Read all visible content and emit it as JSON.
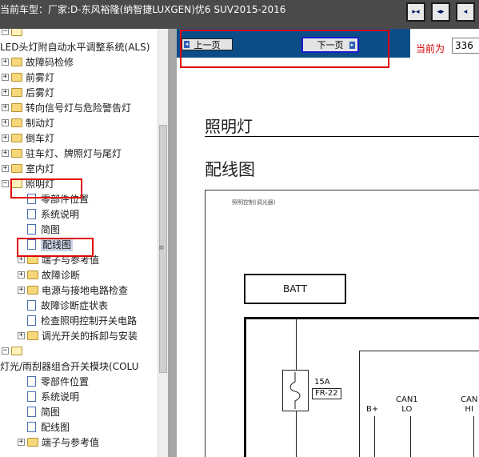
{
  "header": {
    "vehicle_info": "当前车型：厂家:D-东风裕隆(纳智捷LUXGEN)优6 SUV2015-2016",
    "buttons": [
      {
        "icon": "collapse-tree-icon",
        "glyph": "▸◂"
      },
      {
        "icon": "expand-tree-icon",
        "glyph": "◂▸"
      },
      {
        "icon": "maximize-icon",
        "glyph": "◂"
      }
    ]
  },
  "tree": {
    "items": [
      {
        "label": "",
        "expander": "−",
        "kind": "folder-open",
        "level": 0
      },
      {
        "label": "LED头灯附自动水平调整系统(ALS)",
        "expander": "",
        "kind": "text",
        "level": 0
      },
      {
        "label": "故障码检修",
        "expander": "+",
        "kind": "folder",
        "level": 1
      },
      {
        "label": "前雾灯",
        "expander": "+",
        "kind": "folder",
        "level": 1
      },
      {
        "label": "后雾灯",
        "expander": "+",
        "kind": "folder",
        "level": 1
      },
      {
        "label": "转向信号灯与危险警告灯",
        "expander": "+",
        "kind": "folder",
        "level": 1
      },
      {
        "label": "制动灯",
        "expander": "+",
        "kind": "folder",
        "level": 1
      },
      {
        "label": "倒车灯",
        "expander": "+",
        "kind": "folder",
        "level": 1
      },
      {
        "label": "驻车灯、牌照灯与尾灯",
        "expander": "+",
        "kind": "folder",
        "level": 1
      },
      {
        "label": "室内灯",
        "expander": "+",
        "kind": "folder",
        "level": 1
      },
      {
        "label": "照明灯",
        "expander": "−",
        "kind": "folder-open",
        "level": 1
      },
      {
        "label": "零部件位置",
        "expander": "",
        "kind": "doc",
        "level": 2
      },
      {
        "label": "系统说明",
        "expander": "",
        "kind": "doc",
        "level": 2
      },
      {
        "label": "简图",
        "expander": "",
        "kind": "doc",
        "level": 2
      },
      {
        "label": "配线图",
        "expander": "",
        "kind": "doc",
        "level": 2,
        "selected": true
      },
      {
        "label": "端子与参考值",
        "expander": "+",
        "kind": "folder",
        "level": 2
      },
      {
        "label": "故障诊断",
        "expander": "+",
        "kind": "folder",
        "level": 2
      },
      {
        "label": "电源与接地电路检查",
        "expander": "+",
        "kind": "folder",
        "level": 2
      },
      {
        "label": "故障诊断症状表",
        "expander": "",
        "kind": "doc",
        "level": 2
      },
      {
        "label": "检查照明控制开关电路",
        "expander": "",
        "kind": "doc",
        "level": 2
      },
      {
        "label": "调光开关的拆卸与安装",
        "expander": "+",
        "kind": "folder",
        "level": 2
      },
      {
        "label": "",
        "expander": "−",
        "kind": "folder-open",
        "level": 0
      },
      {
        "label": "灯光/雨刮器组合开关模块(COLU",
        "expander": "",
        "kind": "text",
        "level": 0
      },
      {
        "label": "零部件位置",
        "expander": "",
        "kind": "doc",
        "level": 2
      },
      {
        "label": "系统说明",
        "expander": "",
        "kind": "doc",
        "level": 2
      },
      {
        "label": "简图",
        "expander": "",
        "kind": "doc",
        "level": 2
      },
      {
        "label": "配线图",
        "expander": "",
        "kind": "doc",
        "level": 2
      },
      {
        "label": "端子与参考值",
        "expander": "+",
        "kind": "folder",
        "level": 2
      }
    ]
  },
  "pager": {
    "prev_label": "上一页",
    "next_label": "下一页",
    "current_label": "当前为",
    "current_page": "336"
  },
  "document": {
    "section_title": "照明灯",
    "subtitle": "配线图",
    "diagram_caption": "照明控制(调光器)",
    "battery_label": "BATT",
    "fuse_rating": "15A",
    "fuse_id": "FR-22",
    "pins": [
      {
        "label": "B+"
      },
      {
        "label": "CAN1\nLO"
      },
      {
        "label": "CAN\nHI"
      }
    ]
  },
  "colors": {
    "header_bg": "#4a4a4a",
    "nav_strip_bg": "#0d4d87",
    "highlight_box": "#e00000",
    "selected_row_bg": "#c9d3e8"
  }
}
